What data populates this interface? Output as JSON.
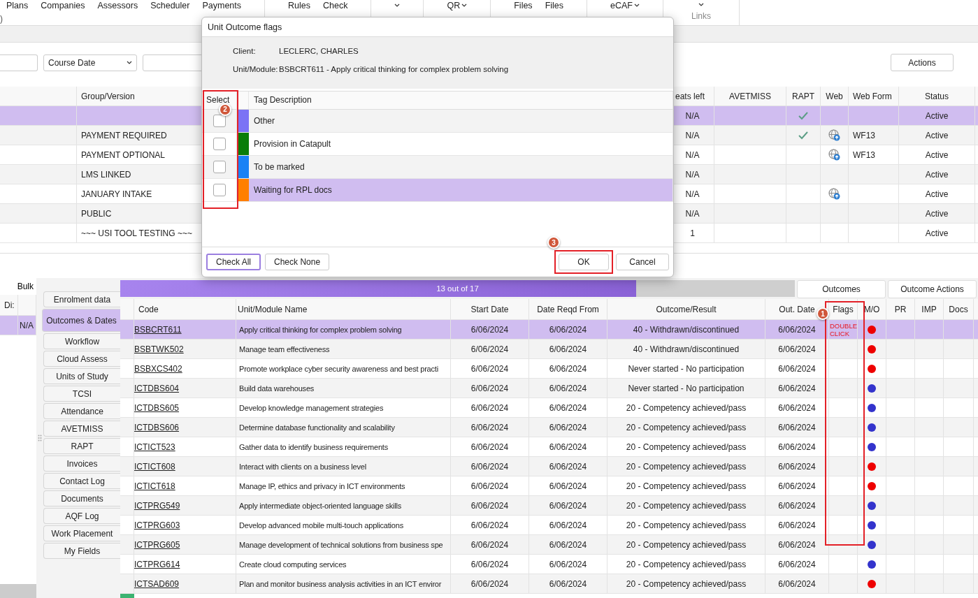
{
  "ribbon": {
    "fragment": ")",
    "items": [
      {
        "kind": "button",
        "label": "Plans"
      },
      {
        "kind": "button",
        "label": "Companies"
      },
      {
        "kind": "button",
        "label": "Assessors"
      },
      {
        "kind": "button",
        "label": "Scheduler"
      },
      {
        "kind": "button",
        "label": "Payments"
      },
      {
        "kind": "separator"
      },
      {
        "kind": "button",
        "label": "Rules"
      },
      {
        "kind": "button",
        "label": "Check"
      },
      {
        "kind": "separator"
      },
      {
        "kind": "caret"
      },
      {
        "kind": "separator"
      },
      {
        "kind": "dropdown",
        "label": "QR"
      },
      {
        "kind": "separator"
      },
      {
        "kind": "button",
        "label": "Files"
      },
      {
        "kind": "button",
        "label": "Files"
      },
      {
        "kind": "separator"
      },
      {
        "kind": "dropdown",
        "label": "eCAF"
      },
      {
        "kind": "separator"
      },
      {
        "kind": "group",
        "label": "Links"
      },
      {
        "kind": "separator"
      }
    ]
  },
  "filters": {
    "sort": "Course Date",
    "actions": "Actions"
  },
  "upper_grid": {
    "columns": [
      "Group/Version",
      "eats left",
      "AVETMISS",
      "RAPT",
      "Web",
      "Web Form",
      "Status"
    ],
    "rows": [
      {
        "group": "",
        "seats": "N/A",
        "rapt": true,
        "web": false,
        "web_form": "",
        "status": "Active",
        "selected": true
      },
      {
        "group": "PAYMENT REQUIRED",
        "seats": "N/A",
        "rapt": true,
        "web": true,
        "web_form": "WF13",
        "status": "Active",
        "selected": false
      },
      {
        "group": "PAYMENT OPTIONAL",
        "seats": "N/A",
        "rapt": false,
        "web": true,
        "web_form": "WF13",
        "status": "Active",
        "selected": false
      },
      {
        "group": "LMS LINKED",
        "seats": "N/A",
        "rapt": false,
        "web": false,
        "web_form": "",
        "status": "Active",
        "selected": false
      },
      {
        "group": "JANUARY INTAKE",
        "seats": "N/A",
        "rapt": false,
        "web": true,
        "web_form": "",
        "status": "Active",
        "selected": false
      },
      {
        "group": "PUBLIC",
        "seats": "N/A",
        "rapt": false,
        "web": false,
        "web_form": "",
        "status": "Active",
        "selected": false
      },
      {
        "group": "~~~ USI TOOL TESTING ~~~",
        "seats": "1",
        "rapt": false,
        "web": false,
        "web_form": "",
        "status": "Active",
        "selected": false
      }
    ]
  },
  "left_panel": {
    "button": "Bulk",
    "column": "Di:",
    "rows": [
      {
        "value": "N/A",
        "selected": true
      }
    ]
  },
  "side_tabs": [
    {
      "label": "Enrolment data",
      "selected": false
    },
    {
      "label": "Outcomes & Dates",
      "selected": true
    },
    {
      "label": "Workflow",
      "selected": false
    },
    {
      "label": "Cloud Assess",
      "selected": false
    },
    {
      "label": "Units of Study",
      "selected": false
    },
    {
      "label": "TCSI",
      "selected": false
    },
    {
      "label": "Attendance",
      "selected": false
    },
    {
      "label": "AVETMISS",
      "selected": false
    },
    {
      "label": "RAPT",
      "selected": false
    },
    {
      "label": "Invoices",
      "selected": false
    },
    {
      "label": "Contact Log",
      "selected": false
    },
    {
      "label": "Documents",
      "selected": false
    },
    {
      "label": "AQF Log",
      "selected": false
    },
    {
      "label": "Work Placement",
      "selected": false
    },
    {
      "label": "My Fields",
      "selected": false
    }
  ],
  "progress": {
    "label": "13 out of 17",
    "level": 0.765
  },
  "outcome_buttons": [
    "Outcomes",
    "Outcome Actions"
  ],
  "outcome_grid": {
    "columns": [
      "Code",
      "Unit/Module Name",
      "Start Date",
      "Date Reqd From",
      "Outcome/Result",
      "Out. Date",
      "Flags",
      "M/O",
      "PR",
      "IMP",
      "Docs"
    ],
    "rows": [
      {
        "code": "BSBCRT611",
        "name": "Apply critical thinking for complex problem solving",
        "start": "6/06/2024",
        "reqd": "6/06/2024",
        "outcome": "40 - Withdrawn/discontinued",
        "out_date": "6/06/2024",
        "flags": "DOUBLE CLICK",
        "color": "#ee0000",
        "selected": true
      },
      {
        "code": "BSBTWK502",
        "name": "Manage team effectiveness",
        "start": "6/06/2024",
        "reqd": "6/06/2024",
        "outcome": "40 - Withdrawn/discontinued",
        "out_date": "6/06/2024",
        "color": "#ee0000",
        "selected": false
      },
      {
        "code": "BSBXCS402",
        "name": "Promote workplace cyber security awareness and best practi",
        "start": "6/06/2024",
        "reqd": "6/06/2024",
        "outcome": "Never started - No participation",
        "out_date": "6/06/2024",
        "color": "#ee0000",
        "selected": false
      },
      {
        "code": "ICTDBS604",
        "name": "Build data warehouses",
        "start": "6/06/2024",
        "reqd": "6/06/2024",
        "outcome": "Never started - No participation",
        "out_date": "6/06/2024",
        "color": "#3333cc",
        "selected": false
      },
      {
        "code": "ICTDBS605",
        "name": "Develop knowledge management strategies",
        "start": "6/06/2024",
        "reqd": "6/06/2024",
        "outcome": "20 - Competency achieved/pass",
        "out_date": "6/06/2024",
        "color": "#3333cc",
        "selected": false
      },
      {
        "code": "ICTDBS606",
        "name": "Determine database functionality and scalability",
        "start": "6/06/2024",
        "reqd": "6/06/2024",
        "outcome": "20 - Competency achieved/pass",
        "out_date": "6/06/2024",
        "color": "#3333cc",
        "selected": false
      },
      {
        "code": "ICTICT523",
        "name": "Gather data to identify business requirements",
        "start": "6/06/2024",
        "reqd": "6/06/2024",
        "outcome": "20 - Competency achieved/pass",
        "out_date": "6/06/2024",
        "color": "#3333cc",
        "selected": false
      },
      {
        "code": "ICTICT608",
        "name": "Interact with clients on a business level",
        "start": "6/06/2024",
        "reqd": "6/06/2024",
        "outcome": "20 - Competency achieved/pass",
        "out_date": "6/06/2024",
        "color": "#ee0000",
        "selected": false
      },
      {
        "code": "ICTICT618",
        "name": "Manage IP, ethics and privacy in ICT environments",
        "start": "6/06/2024",
        "reqd": "6/06/2024",
        "outcome": "20 - Competency achieved/pass",
        "out_date": "6/06/2024",
        "color": "#ee0000",
        "selected": false
      },
      {
        "code": "ICTPRG549",
        "name": "Apply intermediate object-oriented language skills",
        "start": "6/06/2024",
        "reqd": "6/06/2024",
        "outcome": "20 - Competency achieved/pass",
        "out_date": "6/06/2024",
        "color": "#3333cc",
        "selected": false
      },
      {
        "code": "ICTPRG603",
        "name": "Develop advanced mobile multi-touch applications",
        "start": "6/06/2024",
        "reqd": "6/06/2024",
        "outcome": "20 - Competency achieved/pass",
        "out_date": "6/06/2024",
        "color": "#3333cc",
        "selected": false
      },
      {
        "code": "ICTPRG605",
        "name": "Manage development of technical solutions from business spe",
        "start": "6/06/2024",
        "reqd": "6/06/2024",
        "outcome": "20 - Competency achieved/pass",
        "out_date": "6/06/2024",
        "color": "#3333cc",
        "selected": false
      },
      {
        "code": "ICTPRG614",
        "name": "Create cloud computing services",
        "start": "6/06/2024",
        "reqd": "6/06/2024",
        "outcome": "20 - Competency achieved/pass",
        "out_date": "6/06/2024",
        "color": "#3333cc",
        "selected": false
      },
      {
        "code": "ICTSAD609",
        "name": "Plan and monitor business analysis activities in an ICT enviror",
        "start": "6/06/2024",
        "reqd": "6/06/2024",
        "outcome": "20 - Competency achieved/pass",
        "out_date": "6/06/2024",
        "color": "#ee0000",
        "selected": false
      }
    ]
  },
  "dialog": {
    "title": "Unit Outcome flags",
    "info": [
      {
        "label": "Client:",
        "value": "LECLERC, CHARLES"
      },
      {
        "label": "Unit/Module:",
        "value": "BSBCRT611 - Apply critical thinking for complex problem solving"
      }
    ],
    "columns": [
      "Select",
      "Tag Description"
    ],
    "tags": [
      {
        "label": "Other",
        "color": "#7b73f5",
        "checked": false,
        "selected": false
      },
      {
        "label": "Provision in Catapult",
        "color": "#0a7d0a",
        "checked": false,
        "selected": false
      },
      {
        "label": "To be marked",
        "color": "#1a82f5",
        "checked": false,
        "selected": false
      },
      {
        "label": "Waiting for RPL docs",
        "color": "#ff7f00",
        "checked": false,
        "selected": true
      }
    ],
    "buttons": [
      {
        "label": "Check All",
        "focused": true
      },
      {
        "label": "Check None",
        "focused": false
      },
      {
        "label": "OK",
        "focused": false
      },
      {
        "label": "Cancel",
        "focused": false
      }
    ]
  },
  "steps": [
    "1",
    "2",
    "3"
  ]
}
